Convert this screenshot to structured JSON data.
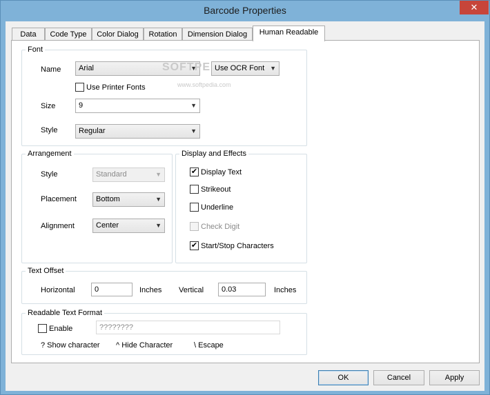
{
  "window": {
    "title": "Barcode Properties",
    "close_glyph": "✕"
  },
  "tabs": [
    {
      "label": "Data",
      "active": false
    },
    {
      "label": "Code Type",
      "active": false
    },
    {
      "label": "Color Dialog",
      "active": false
    },
    {
      "label": "Rotation",
      "active": false
    },
    {
      "label": "Dimension Dialog",
      "active": false
    },
    {
      "label": "Human Readable",
      "active": true
    }
  ],
  "font_group": {
    "title": "Font",
    "name_label": "Name",
    "name_value": "Arial",
    "ocr_button": "Use OCR Font",
    "use_printer_fonts": {
      "label": "Use Printer Fonts",
      "checked": false
    },
    "size_label": "Size",
    "size_value": "9",
    "style_label": "Style",
    "style_value": "Regular"
  },
  "arrangement": {
    "title": "Arrangement",
    "style_label": "Style",
    "style_value": "Standard",
    "placement_label": "Placement",
    "placement_value": "Bottom",
    "alignment_label": "Alignment",
    "alignment_value": "Center"
  },
  "display_effects": {
    "title": "Display and Effects",
    "items": [
      {
        "label": "Display Text",
        "checked": true,
        "enabled": true
      },
      {
        "label": "Strikeout",
        "checked": false,
        "enabled": true
      },
      {
        "label": "Underline",
        "checked": false,
        "enabled": true
      },
      {
        "label": "Check Digit",
        "checked": false,
        "enabled": false
      },
      {
        "label": "Start/Stop Characters",
        "checked": true,
        "enabled": true
      }
    ]
  },
  "text_offset": {
    "title": "Text Offset",
    "horizontal_label": "Horizontal",
    "horizontal_value": "0",
    "horizontal_unit": "Inches",
    "vertical_label": "Vertical",
    "vertical_value": "0.03",
    "vertical_unit": "Inches"
  },
  "readable_format": {
    "title": "Readable Text Format",
    "enable_label": "Enable",
    "enable_checked": false,
    "format_placeholder": "????????",
    "hint_show": "? Show character",
    "hint_hide": "^ Hide Character",
    "hint_escape": "\\ Escape"
  },
  "buttons": {
    "ok": "OK",
    "cancel": "Cancel",
    "apply": "Apply"
  },
  "watermark": {
    "main": "SOFTPEDIA",
    "sub": "www.softpedia.com"
  },
  "glyphs": {
    "dropdown_arrow": "▼",
    "check_mark": "✔"
  }
}
